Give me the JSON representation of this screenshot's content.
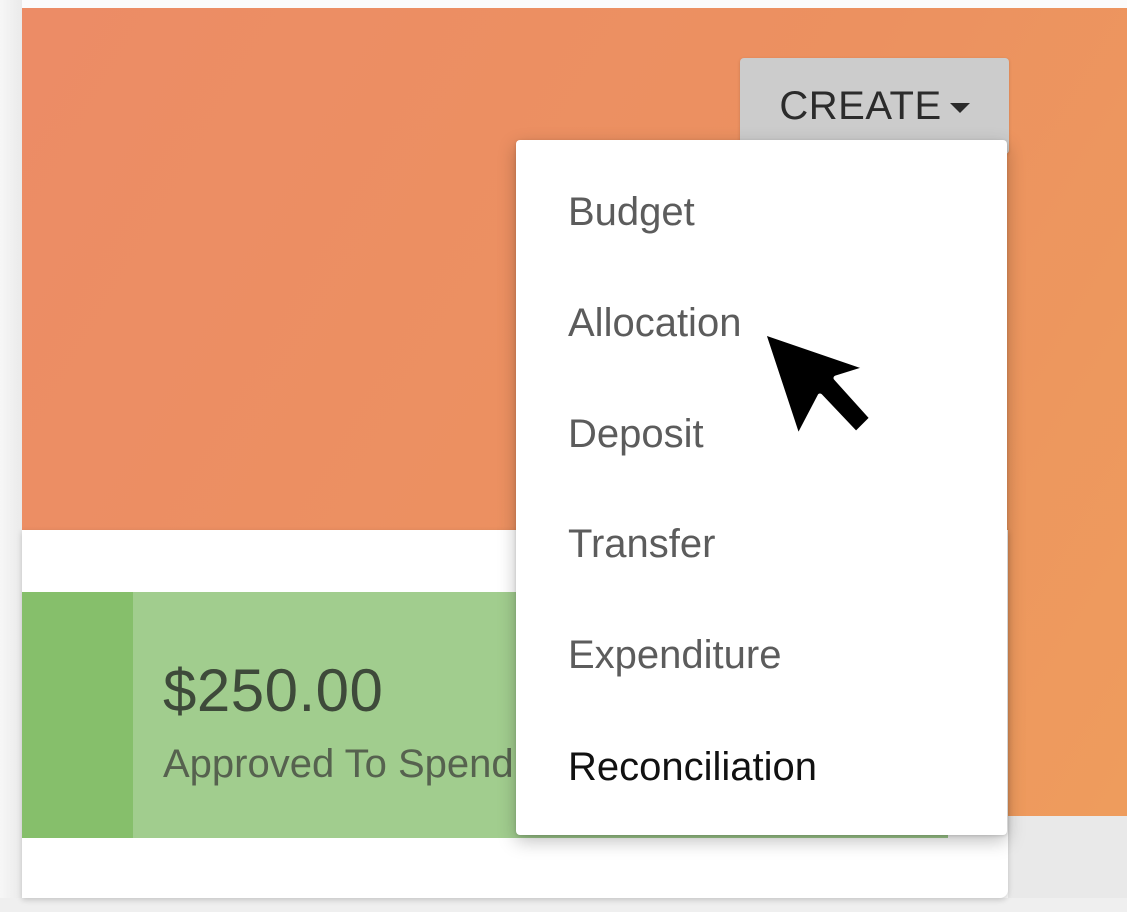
{
  "header": {
    "create_button_label": "CREATE",
    "create_button_icon": "caret-down-icon"
  },
  "create_menu": {
    "items": [
      {
        "label": "Budget"
      },
      {
        "label": "Allocation"
      },
      {
        "label": "Deposit"
      },
      {
        "label": "Transfer"
      },
      {
        "label": "Expenditure"
      },
      {
        "label": "Reconciliation"
      }
    ],
    "hovered_item": "Allocation"
  },
  "summary_card": {
    "amount": "$250.00",
    "label": "Approved To Spend"
  },
  "colors": {
    "hero_background": "#ec9162",
    "stat_panel": "#a1cd8e",
    "stat_accent": "#86bf6b",
    "create_button": "#cccccc"
  },
  "pointer": {
    "icon": "mouse-pointer-icon"
  }
}
